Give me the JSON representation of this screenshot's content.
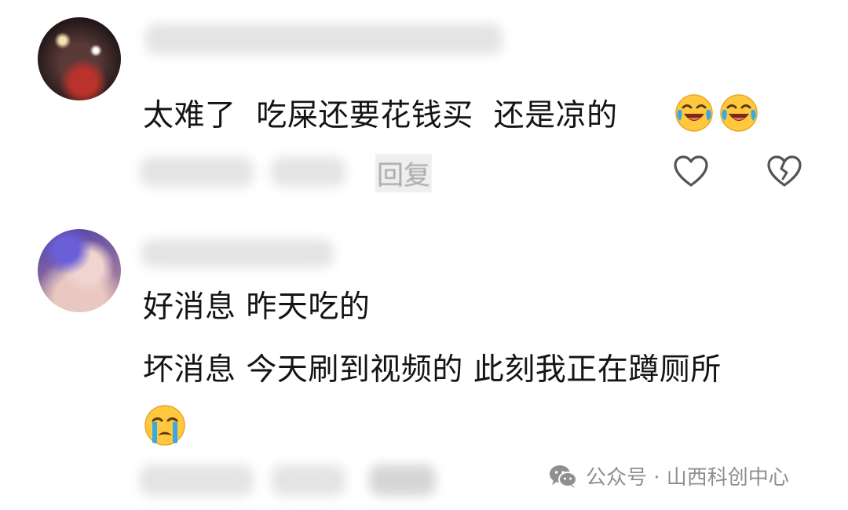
{
  "comments": [
    {
      "text": "太难了  吃屎还要花钱买  还是凉的",
      "reply_label": "回复",
      "reactions": [
        "laughing-crying-emoji",
        "laughing-crying-emoji"
      ]
    },
    {
      "lines": [
        "好消息 昨天吃的",
        "坏消息 今天刷到视频的 此刻我正在蹲厕所"
      ],
      "reactions": [
        "crying-emoji"
      ]
    }
  ],
  "icons": {
    "like": "heart-outline-icon",
    "dislike": "broken-heart-outline-icon",
    "watermark": "wechat-icon"
  },
  "watermark": {
    "text": "公众号 · 山西科创中心"
  },
  "colors": {
    "text": "#141414",
    "muted": "#8f8f8f",
    "icon_stroke": "#555555",
    "emoji_yellow": "#ffc83d",
    "tear_blue": "#38a9e6"
  }
}
